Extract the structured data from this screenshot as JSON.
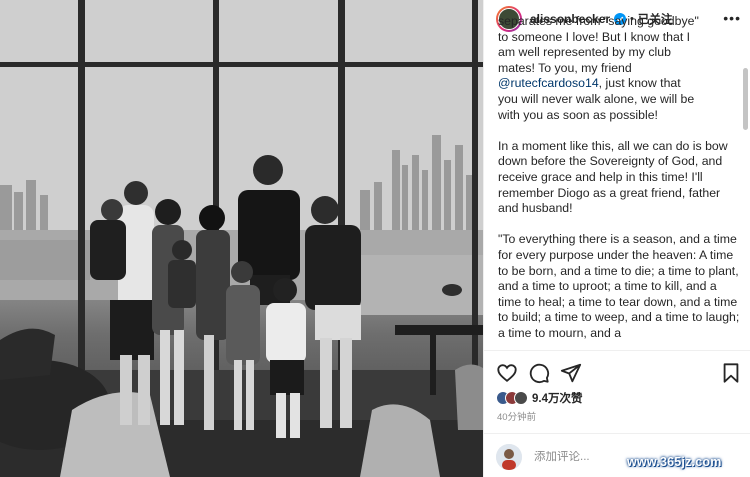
{
  "post": {
    "username": "alissonbecker",
    "follow_state": "已关注",
    "separator": "•",
    "more_label": "•••",
    "caption": {
      "p1_line1": "separates me from \"saying goodbye\"",
      "p1_line2": "to someone I love! But I know that I",
      "p1_line3": "am well represented by my club",
      "p1_line4": "mates! To you, my friend",
      "mention": "@rutecfcardoso14",
      "p1_after_mention": ", just know that",
      "p1_line6": "you will never walk alone, we will be",
      "p1_line7": "with you as soon as possible!",
      "p2": "In a moment like this, all we can do is bow down before the Sovereignty of God, and receive grace and help in this time! I'll remember Diogo as a great friend, father and husband!",
      "p3": "\"To everything there is a season, and a time for every purpose under the heaven: A time to be born, and a time to die; a time to plant, and a time to uproot; a time to kill, and a time to heal; a time to tear down, and a time to build; a time to weep, and a time to laugh; a time to mourn, and a"
    },
    "likes_count": "9.4万次赞",
    "time_ago": "40分钟前",
    "comment_placeholder": "添加评论..."
  },
  "colors": {
    "text": "#262626",
    "secondary": "#8e8e8e",
    "link": "#00376b",
    "verified": "#0095f6"
  },
  "watermark": "www.365jz.com"
}
